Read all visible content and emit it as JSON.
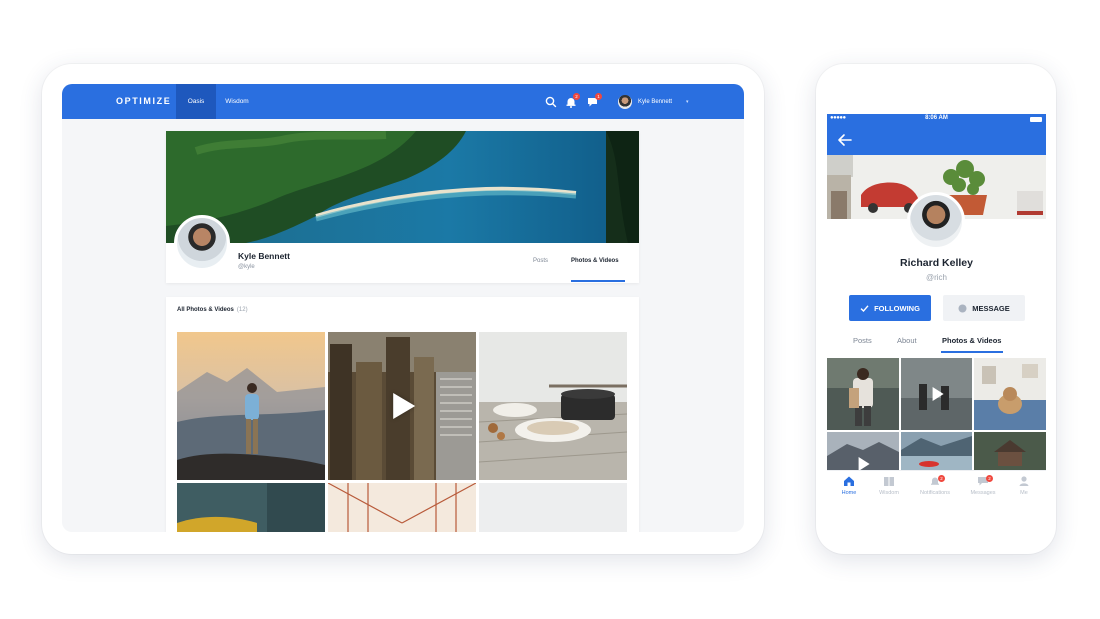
{
  "tablet": {
    "nav": {
      "brand": "OPTIMIZE",
      "tabs": [
        {
          "label": "Oasis",
          "active": true
        },
        {
          "label": "Wisdom",
          "active": false
        }
      ],
      "icons": [
        "search-icon",
        "notification-bell-icon",
        "messages-icon"
      ],
      "notification_badge": "2",
      "messages_badge": "1",
      "user_name": "Kyle Bennett",
      "accent_color": "#2a6fe0"
    },
    "profile": {
      "name": "Kyle Bennett",
      "handle": "@kyle",
      "tabs": [
        {
          "label": "Posts",
          "active": false
        },
        {
          "label": "Photos & Videos",
          "active": true
        }
      ]
    },
    "gallery": {
      "title": "All Photos & Videos",
      "count": "(12)"
    }
  },
  "phone": {
    "status": {
      "time": "8:06 AM",
      "signal": "●●●●●"
    },
    "profile": {
      "name": "Richard Kelley",
      "handle": "@rich",
      "follow_label": "FOLLOWING",
      "message_label": "MESSAGE",
      "tabs": [
        {
          "label": "Posts",
          "active": false
        },
        {
          "label": "About",
          "active": false
        },
        {
          "label": "Photos & Videos",
          "active": true
        }
      ]
    },
    "tabbar": [
      {
        "label": "Home",
        "icon": "home-icon",
        "active": true
      },
      {
        "label": "Wisdom",
        "icon": "book-icon",
        "active": false
      },
      {
        "label": "Notifications",
        "icon": "bell-icon",
        "active": false,
        "badge": "2"
      },
      {
        "label": "Messages",
        "icon": "chat-icon",
        "active": false,
        "badge": "2"
      },
      {
        "label": "Me",
        "icon": "user-icon",
        "active": false
      }
    ]
  }
}
